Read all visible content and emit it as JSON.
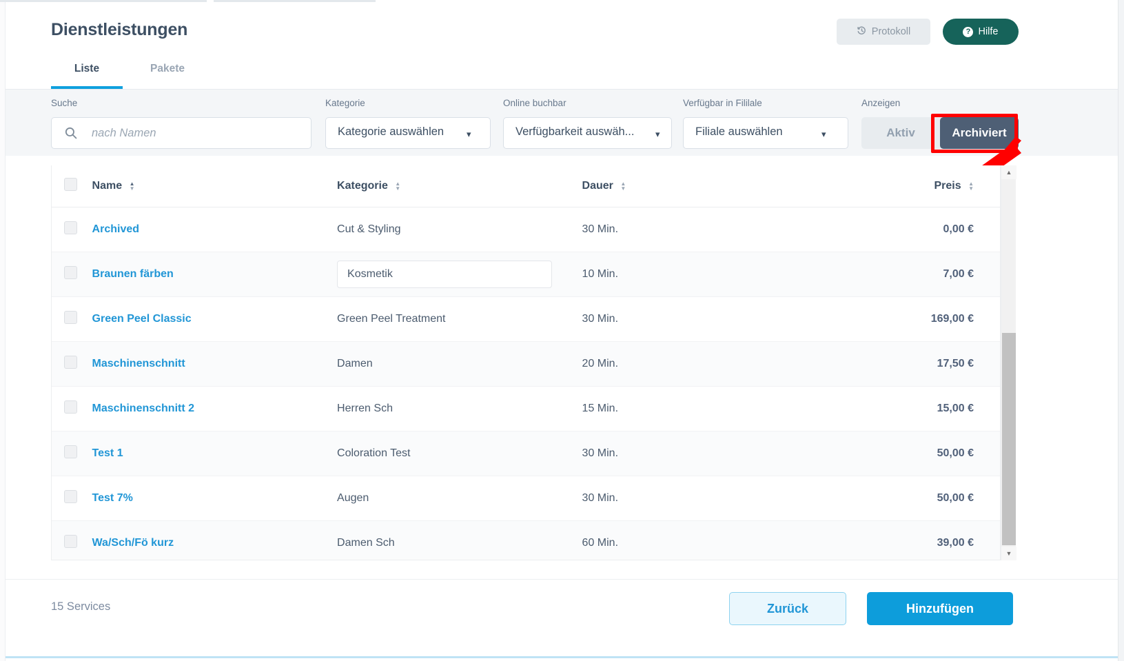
{
  "header": {
    "title": "Dienstleistungen",
    "protokoll_label": "Protokoll",
    "protokoll_icon": "history-icon",
    "hilfe_label": "Hilfe",
    "hilfe_icon": "question-circle-icon"
  },
  "tabs": [
    {
      "label": "Liste",
      "active": true
    },
    {
      "label": "Pakete",
      "active": false
    }
  ],
  "filters": {
    "search": {
      "label": "Suche",
      "placeholder": "nach Namen",
      "value": "",
      "icon": "search-icon"
    },
    "kategorie": {
      "label": "Kategorie",
      "selected": "Kategorie auswählen"
    },
    "online_buchbar": {
      "label": "Online buchbar",
      "selected": "Verfügbarkeit auswäh..."
    },
    "filiale": {
      "label": "Verfügbar in Fililale",
      "selected": "Filiale auswählen"
    },
    "anzeigen": {
      "label": "Anzeigen",
      "options": [
        "Aktiv",
        "Archiviert"
      ],
      "selected": "Archiviert"
    }
  },
  "table": {
    "columns": [
      "Name",
      "Kategorie",
      "Dauer",
      "Preis"
    ],
    "rows": [
      {
        "name": "Archived",
        "kategorie": "Cut & Styling",
        "dauer": "30 Min.",
        "preis": "0,00 €",
        "kategorie_editing": false
      },
      {
        "name": "Braunen färben",
        "kategorie": "Kosmetik",
        "dauer": "10 Min.",
        "preis": "7,00 €",
        "kategorie_editing": true
      },
      {
        "name": "Green Peel Classic",
        "kategorie": "Green Peel Treatment",
        "dauer": "30 Min.",
        "preis": "169,00 €",
        "kategorie_editing": false
      },
      {
        "name": "Maschinenschnitt",
        "kategorie": "Damen",
        "dauer": "20 Min.",
        "preis": "17,50 €",
        "kategorie_editing": false
      },
      {
        "name": "Maschinenschnitt 2",
        "kategorie": "Herren Sch",
        "dauer": "15 Min.",
        "preis": "15,00 €",
        "kategorie_editing": false
      },
      {
        "name": "Test 1",
        "kategorie": "Coloration Test",
        "dauer": "30 Min.",
        "preis": "50,00 €",
        "kategorie_editing": false
      },
      {
        "name": "Test 7%",
        "kategorie": "Augen",
        "dauer": "30 Min.",
        "preis": "50,00 €",
        "kategorie_editing": false
      },
      {
        "name": "Wa/Sch/Fö kurz",
        "kategorie": "Damen Sch",
        "dauer": "60 Min.",
        "preis": "39,00 €",
        "kategorie_editing": false
      }
    ]
  },
  "footer": {
    "service_count": "15 Services",
    "back_label": "Zurück",
    "add_label": "Hinzufügen"
  },
  "annotation": {
    "type": "red-highlight-arrow",
    "target": "Archiviert"
  },
  "colors": {
    "accent_blue": "#0fa0de",
    "link_blue": "#2196d6",
    "primary_button": "#0d9ddb",
    "help_green": "#16635a",
    "toggle_active": "#4e5f75",
    "annotation_red": "#ff0000",
    "text_dark": "#3d4f63"
  }
}
